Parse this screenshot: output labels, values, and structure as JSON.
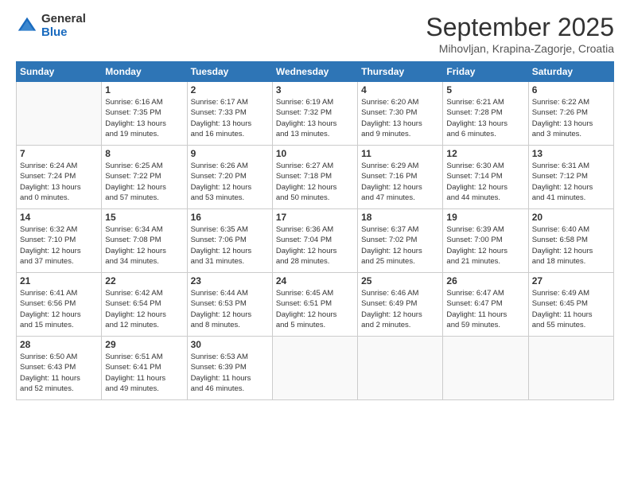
{
  "logo": {
    "general": "General",
    "blue": "Blue"
  },
  "title": {
    "month": "September 2025",
    "location": "Mihovljan, Krapina-Zagorje, Croatia"
  },
  "weekdays": [
    "Sunday",
    "Monday",
    "Tuesday",
    "Wednesday",
    "Thursday",
    "Friday",
    "Saturday"
  ],
  "weeks": [
    [
      {
        "day": "",
        "info": ""
      },
      {
        "day": "1",
        "info": "Sunrise: 6:16 AM\nSunset: 7:35 PM\nDaylight: 13 hours\nand 19 minutes."
      },
      {
        "day": "2",
        "info": "Sunrise: 6:17 AM\nSunset: 7:33 PM\nDaylight: 13 hours\nand 16 minutes."
      },
      {
        "day": "3",
        "info": "Sunrise: 6:19 AM\nSunset: 7:32 PM\nDaylight: 13 hours\nand 13 minutes."
      },
      {
        "day": "4",
        "info": "Sunrise: 6:20 AM\nSunset: 7:30 PM\nDaylight: 13 hours\nand 9 minutes."
      },
      {
        "day": "5",
        "info": "Sunrise: 6:21 AM\nSunset: 7:28 PM\nDaylight: 13 hours\nand 6 minutes."
      },
      {
        "day": "6",
        "info": "Sunrise: 6:22 AM\nSunset: 7:26 PM\nDaylight: 13 hours\nand 3 minutes."
      }
    ],
    [
      {
        "day": "7",
        "info": "Sunrise: 6:24 AM\nSunset: 7:24 PM\nDaylight: 13 hours\nand 0 minutes."
      },
      {
        "day": "8",
        "info": "Sunrise: 6:25 AM\nSunset: 7:22 PM\nDaylight: 12 hours\nand 57 minutes."
      },
      {
        "day": "9",
        "info": "Sunrise: 6:26 AM\nSunset: 7:20 PM\nDaylight: 12 hours\nand 53 minutes."
      },
      {
        "day": "10",
        "info": "Sunrise: 6:27 AM\nSunset: 7:18 PM\nDaylight: 12 hours\nand 50 minutes."
      },
      {
        "day": "11",
        "info": "Sunrise: 6:29 AM\nSunset: 7:16 PM\nDaylight: 12 hours\nand 47 minutes."
      },
      {
        "day": "12",
        "info": "Sunrise: 6:30 AM\nSunset: 7:14 PM\nDaylight: 12 hours\nand 44 minutes."
      },
      {
        "day": "13",
        "info": "Sunrise: 6:31 AM\nSunset: 7:12 PM\nDaylight: 12 hours\nand 41 minutes."
      }
    ],
    [
      {
        "day": "14",
        "info": "Sunrise: 6:32 AM\nSunset: 7:10 PM\nDaylight: 12 hours\nand 37 minutes."
      },
      {
        "day": "15",
        "info": "Sunrise: 6:34 AM\nSunset: 7:08 PM\nDaylight: 12 hours\nand 34 minutes."
      },
      {
        "day": "16",
        "info": "Sunrise: 6:35 AM\nSunset: 7:06 PM\nDaylight: 12 hours\nand 31 minutes."
      },
      {
        "day": "17",
        "info": "Sunrise: 6:36 AM\nSunset: 7:04 PM\nDaylight: 12 hours\nand 28 minutes."
      },
      {
        "day": "18",
        "info": "Sunrise: 6:37 AM\nSunset: 7:02 PM\nDaylight: 12 hours\nand 25 minutes."
      },
      {
        "day": "19",
        "info": "Sunrise: 6:39 AM\nSunset: 7:00 PM\nDaylight: 12 hours\nand 21 minutes."
      },
      {
        "day": "20",
        "info": "Sunrise: 6:40 AM\nSunset: 6:58 PM\nDaylight: 12 hours\nand 18 minutes."
      }
    ],
    [
      {
        "day": "21",
        "info": "Sunrise: 6:41 AM\nSunset: 6:56 PM\nDaylight: 12 hours\nand 15 minutes."
      },
      {
        "day": "22",
        "info": "Sunrise: 6:42 AM\nSunset: 6:54 PM\nDaylight: 12 hours\nand 12 minutes."
      },
      {
        "day": "23",
        "info": "Sunrise: 6:44 AM\nSunset: 6:53 PM\nDaylight: 12 hours\nand 8 minutes."
      },
      {
        "day": "24",
        "info": "Sunrise: 6:45 AM\nSunset: 6:51 PM\nDaylight: 12 hours\nand 5 minutes."
      },
      {
        "day": "25",
        "info": "Sunrise: 6:46 AM\nSunset: 6:49 PM\nDaylight: 12 hours\nand 2 minutes."
      },
      {
        "day": "26",
        "info": "Sunrise: 6:47 AM\nSunset: 6:47 PM\nDaylight: 11 hours\nand 59 minutes."
      },
      {
        "day": "27",
        "info": "Sunrise: 6:49 AM\nSunset: 6:45 PM\nDaylight: 11 hours\nand 55 minutes."
      }
    ],
    [
      {
        "day": "28",
        "info": "Sunrise: 6:50 AM\nSunset: 6:43 PM\nDaylight: 11 hours\nand 52 minutes."
      },
      {
        "day": "29",
        "info": "Sunrise: 6:51 AM\nSunset: 6:41 PM\nDaylight: 11 hours\nand 49 minutes."
      },
      {
        "day": "30",
        "info": "Sunrise: 6:53 AM\nSunset: 6:39 PM\nDaylight: 11 hours\nand 46 minutes."
      },
      {
        "day": "",
        "info": ""
      },
      {
        "day": "",
        "info": ""
      },
      {
        "day": "",
        "info": ""
      },
      {
        "day": "",
        "info": ""
      }
    ]
  ]
}
